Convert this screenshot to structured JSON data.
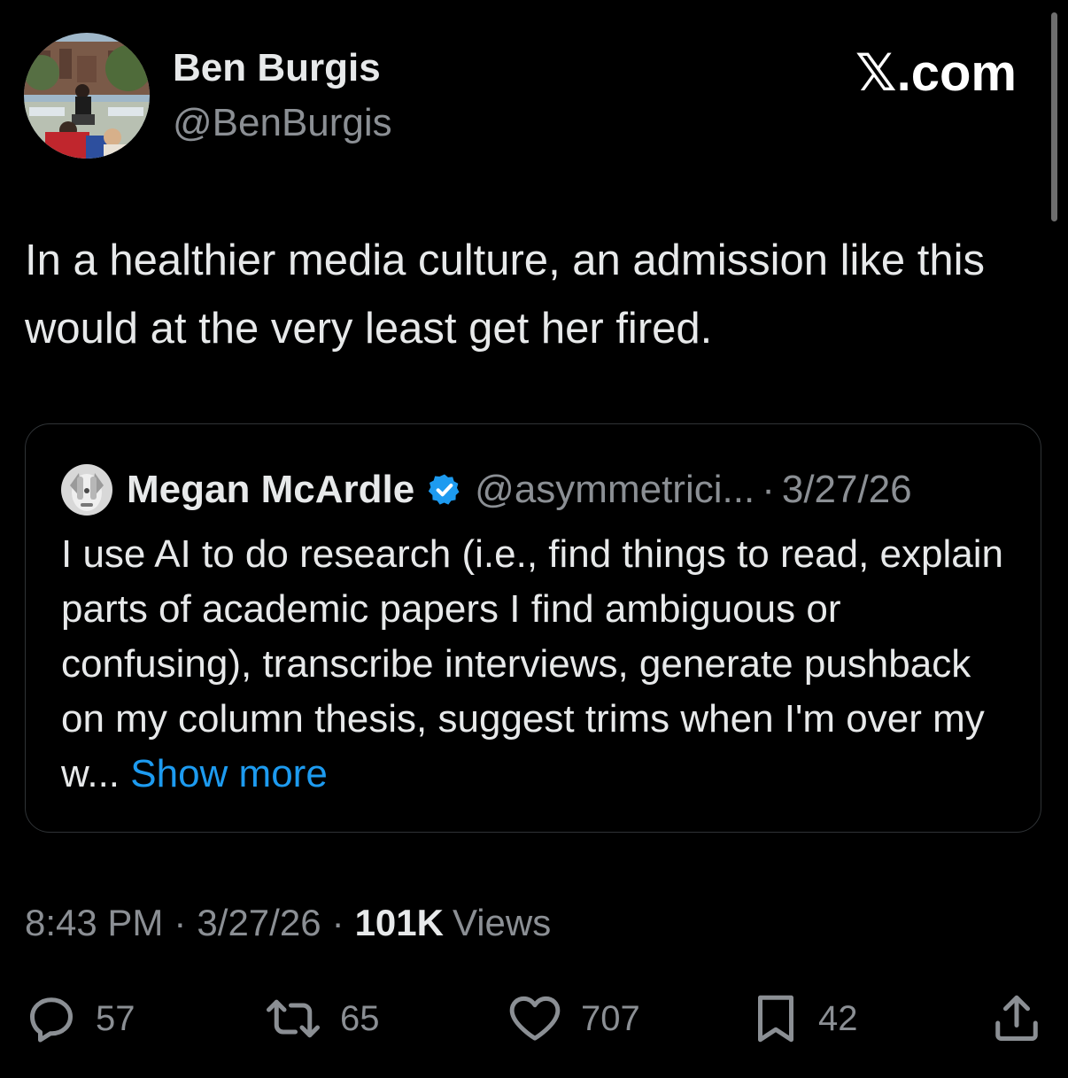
{
  "author": {
    "name": "Ben Burgis",
    "handle": "@BenBurgis"
  },
  "site": {
    "logo": "𝕏.com"
  },
  "tweet": {
    "text": "In a healthier media culture, an admission like this would at the very least get her fired."
  },
  "quoted_tweet": {
    "name": "Megan McArdle",
    "verified_icon": "verified-badge-icon",
    "handle": "@asymmetrici...",
    "separator": "·",
    "date": "3/27/26",
    "text": "I use AI to do research (i.e., find things to read, explain parts of academic papers I find ambiguous or confusing), transcribe interviews, generate pushback on my column thesis, suggest trims when I'm over my w...",
    "show_more": "Show more"
  },
  "meta": {
    "time": "8:43 PM",
    "separator": "·",
    "date": "3/27/26",
    "views_count": "101K",
    "views_label": "Views"
  },
  "actions": {
    "replies": "57",
    "reposts": "65",
    "likes": "707",
    "bookmarks": "42"
  },
  "colors": {
    "background": "#000000",
    "text_primary": "#e7e9ea",
    "text_secondary": "#8b8f94",
    "link": "#1d9bf0",
    "verified": "#1d9bf0",
    "card_border": "#2f3336"
  },
  "icons": {
    "reply": "reply-icon",
    "repost": "repost-icon",
    "like": "heart-icon",
    "bookmark": "bookmark-icon",
    "share": "share-icon"
  }
}
